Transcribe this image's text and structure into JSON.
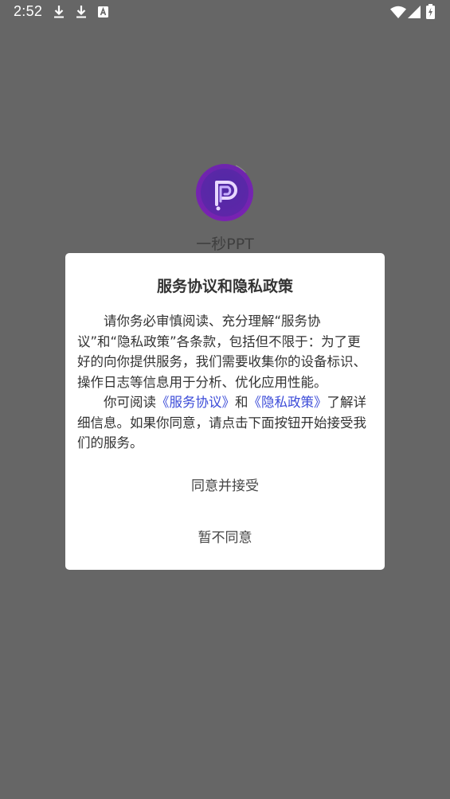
{
  "status_bar": {
    "time": "2:52",
    "icons": [
      "download-icon",
      "download-icon",
      "keyboard-a-icon",
      "wifi-icon",
      "signal-icon",
      "battery-charging-icon"
    ]
  },
  "app": {
    "name": "一秒PPT",
    "logo_colors": {
      "outer": "#7b2fb8",
      "inner": "#3a2a9e"
    }
  },
  "dialog": {
    "title": "服务协议和隐私政策",
    "paragraph1": "请你务必审慎阅读、充分理解“服务协议”和“隐私政策”各条款，包括但不限于：为了更好的向你提供服务，我们需要收集你的设备标识、操作日志等信息用于分析、优化应用性能。",
    "paragraph2_prefix": "你可阅读",
    "service_link": "《服务协议》",
    "and": "和",
    "privacy_link": "《隐私政策》",
    "paragraph2_suffix": "了解详细信息。如果你同意，请点击下面按钮开始接受我们的服务。",
    "agree_button": "同意并接受",
    "disagree_button": "暂不同意"
  },
  "colors": {
    "overlay_bg": "#666666",
    "link": "#3b4bd8"
  }
}
